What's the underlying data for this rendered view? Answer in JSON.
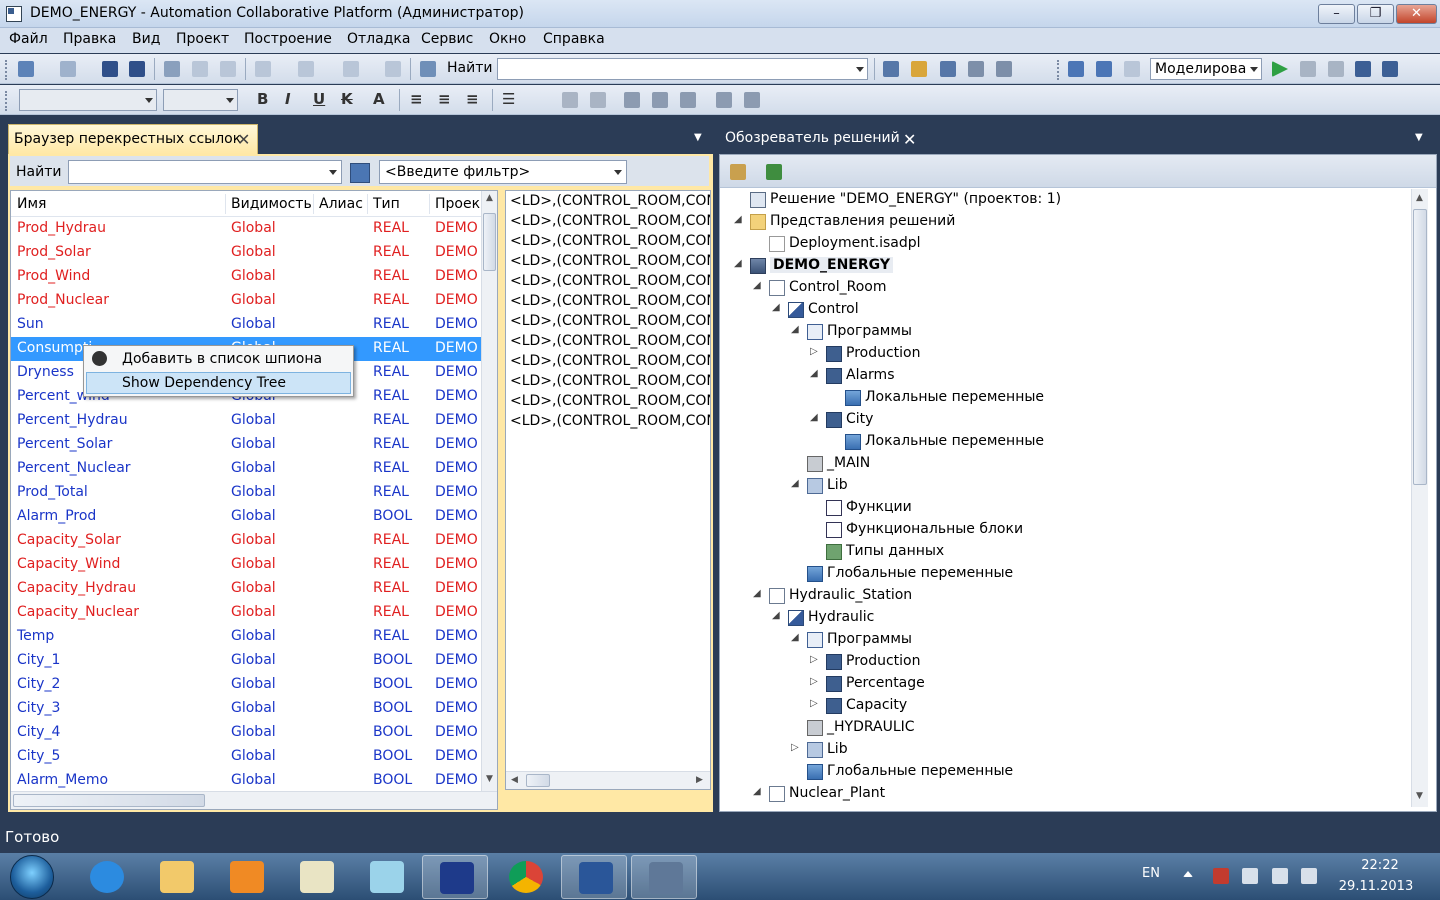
{
  "window": {
    "title": "DEMO_ENERGY - Automation Collaborative Platform (Администратор)",
    "min": "–",
    "max": "❐",
    "close": "✕"
  },
  "menu": [
    "Файл",
    "Правка",
    "Вид",
    "Проект",
    "Построение",
    "Отладка",
    "Сервис",
    "Окно",
    "Справка"
  ],
  "toolbar": {
    "find_label": "Найти",
    "find_value": "",
    "mode_value": "Моделирова"
  },
  "xref": {
    "tab_label": "Браузер перекрестных ссылок",
    "find_label": "Найти",
    "filter_placeholder": "<Введите фильтр>",
    "columns": [
      "Имя",
      "Видимость",
      "Алиас",
      "Тип",
      "Проек"
    ],
    "rows": [
      {
        "name": "Prod_Hydrau",
        "visibility": "Global",
        "alias": "",
        "type": "REAL",
        "project": "DEMO",
        "color": "#e02020"
      },
      {
        "name": "Prod_Solar",
        "visibility": "Global",
        "alias": "",
        "type": "REAL",
        "project": "DEMO",
        "color": "#e02020"
      },
      {
        "name": "Prod_Wind",
        "visibility": "Global",
        "alias": "",
        "type": "REAL",
        "project": "DEMO",
        "color": "#e02020"
      },
      {
        "name": "Prod_Nuclear",
        "visibility": "Global",
        "alias": "",
        "type": "REAL",
        "project": "DEMO",
        "color": "#e02020"
      },
      {
        "name": "Sun",
        "visibility": "Global",
        "alias": "",
        "type": "REAL",
        "project": "DEMO",
        "color": "#1a35c8"
      },
      {
        "name": "Consumpti",
        "visibility": "Global",
        "alias": "",
        "type": "REAL",
        "project": "DEMO",
        "color": "#1a35c8"
      },
      {
        "name": "Dryness",
        "visibility": "Global",
        "alias": "",
        "type": "REAL",
        "project": "DEMO",
        "color": "#1a35c8"
      },
      {
        "name": "Percent_wind",
        "visibility": "Global",
        "alias": "",
        "type": "REAL",
        "project": "DEMO",
        "color": "#1a35c8"
      },
      {
        "name": "Percent_Hydrau",
        "visibility": "Global",
        "alias": "",
        "type": "REAL",
        "project": "DEMO",
        "color": "#1a35c8"
      },
      {
        "name": "Percent_Solar",
        "visibility": "Global",
        "alias": "",
        "type": "REAL",
        "project": "DEMO",
        "color": "#1a35c8"
      },
      {
        "name": "Percent_Nuclear",
        "visibility": "Global",
        "alias": "",
        "type": "REAL",
        "project": "DEMO",
        "color": "#1a35c8"
      },
      {
        "name": "Prod_Total",
        "visibility": "Global",
        "alias": "",
        "type": "REAL",
        "project": "DEMO",
        "color": "#1a35c8"
      },
      {
        "name": "Alarm_Prod",
        "visibility": "Global",
        "alias": "",
        "type": "BOOL",
        "project": "DEMO",
        "color": "#1a35c8"
      },
      {
        "name": "Capacity_Solar",
        "visibility": "Global",
        "alias": "",
        "type": "REAL",
        "project": "DEMO",
        "color": "#e02020"
      },
      {
        "name": "Capacity_Wind",
        "visibility": "Global",
        "alias": "",
        "type": "REAL",
        "project": "DEMO",
        "color": "#e02020"
      },
      {
        "name": "Capacity_Hydrau",
        "visibility": "Global",
        "alias": "",
        "type": "REAL",
        "project": "DEMO",
        "color": "#e02020"
      },
      {
        "name": "Capacity_Nuclear",
        "visibility": "Global",
        "alias": "",
        "type": "REAL",
        "project": "DEMO",
        "color": "#e02020"
      },
      {
        "name": "Temp",
        "visibility": "Global",
        "alias": "",
        "type": "REAL",
        "project": "DEMO",
        "color": "#1a35c8"
      },
      {
        "name": "City_1",
        "visibility": "Global",
        "alias": "",
        "type": "BOOL",
        "project": "DEMO",
        "color": "#1a35c8"
      },
      {
        "name": "City_2",
        "visibility": "Global",
        "alias": "",
        "type": "BOOL",
        "project": "DEMO",
        "color": "#1a35c8"
      },
      {
        "name": "City_3",
        "visibility": "Global",
        "alias": "",
        "type": "BOOL",
        "project": "DEMO",
        "color": "#1a35c8"
      },
      {
        "name": "City_4",
        "visibility": "Global",
        "alias": "",
        "type": "BOOL",
        "project": "DEMO",
        "color": "#1a35c8"
      },
      {
        "name": "City_5",
        "visibility": "Global",
        "alias": "",
        "type": "BOOL",
        "project": "DEMO",
        "color": "#1a35c8"
      },
      {
        "name": "Alarm_Memo",
        "visibility": "Global",
        "alias": "",
        "type": "BOOL",
        "project": "DEMO",
        "color": "#1a35c8"
      }
    ],
    "selected_row": 5,
    "instructions": [
      "<LD>,(CONTROL_ROOM,CONT",
      "<LD>,(CONTROL_ROOM,CONT",
      "<LD>,(CONTROL_ROOM,CONT",
      "<LD>,(CONTROL_ROOM,CONT",
      "<LD>,(CONTROL_ROOM,CONT",
      "<LD>,(CONTROL_ROOM,CONT",
      "<LD>,(CONTROL_ROOM,CONT",
      "<LD>,(CONTROL_ROOM,CONT",
      "<LD>,(CONTROL_ROOM,CONT",
      "<LD>,(CONTROL_ROOM,CONT",
      "<LD>,(CONTROL_ROOM,CONT",
      "<LD>,(CONTROL_ROOM,CONT"
    ]
  },
  "context_menu": {
    "spy_label": "Добавить в список шпиона",
    "dependency_label": "Show Dependency Tree"
  },
  "solution": {
    "tab_label": "Обозреватель решений",
    "tree": [
      {
        "label": "Решение \"DEMO_ENERGY\"  (проектов: 1)",
        "level": 0,
        "exp": "",
        "icon": "sol"
      },
      {
        "label": "Представления решений",
        "level": 0,
        "exp": "◢",
        "icon": "folder"
      },
      {
        "label": "Deployment.isadpl",
        "level": 1,
        "exp": "",
        "icon": "file"
      },
      {
        "label": "DEMO_ENERGY",
        "level": 0,
        "exp": "◢",
        "icon": "proj",
        "bold": true
      },
      {
        "label": "Control_Room",
        "level": 1,
        "exp": "◢",
        "icon": "res"
      },
      {
        "label": "Control",
        "level": 2,
        "exp": "◢",
        "icon": "cfg"
      },
      {
        "label": "Программы",
        "level": 3,
        "exp": "◢",
        "icon": "prog"
      },
      {
        "label": "Production",
        "level": 4,
        "exp": "▷",
        "icon": "pou"
      },
      {
        "label": "Alarms",
        "level": 4,
        "exp": "◢",
        "icon": "pou"
      },
      {
        "label": "Локальные переменные",
        "level": 5,
        "exp": "",
        "icon": "vars"
      },
      {
        "label": "City",
        "level": 4,
        "exp": "◢",
        "icon": "pou"
      },
      {
        "label": "Локальные переменные",
        "level": 5,
        "exp": "",
        "icon": "vars"
      },
      {
        "label": "_MAIN",
        "level": 3,
        "exp": "",
        "icon": "main"
      },
      {
        "label": "Lib",
        "level": 3,
        "exp": "◢",
        "icon": "lib"
      },
      {
        "label": "Функции",
        "level": 4,
        "exp": "",
        "icon": "func"
      },
      {
        "label": "Функциональные блоки",
        "level": 4,
        "exp": "",
        "icon": "func"
      },
      {
        "label": "Типы данных",
        "level": 4,
        "exp": "",
        "icon": "type"
      },
      {
        "label": "Глобальные переменные",
        "level": 3,
        "exp": "",
        "icon": "vars"
      },
      {
        "label": "Hydraulic_Station",
        "level": 1,
        "exp": "◢",
        "icon": "res"
      },
      {
        "label": "Hydraulic",
        "level": 2,
        "exp": "◢",
        "icon": "cfg"
      },
      {
        "label": "Программы",
        "level": 3,
        "exp": "◢",
        "icon": "prog"
      },
      {
        "label": "Production",
        "level": 4,
        "exp": "▷",
        "icon": "pou"
      },
      {
        "label": "Percentage",
        "level": 4,
        "exp": "▷",
        "icon": "pou"
      },
      {
        "label": "Capacity",
        "level": 4,
        "exp": "▷",
        "icon": "pou"
      },
      {
        "label": "_HYDRAULIC",
        "level": 3,
        "exp": "",
        "icon": "main"
      },
      {
        "label": "Lib",
        "level": 3,
        "exp": "▷",
        "icon": "lib"
      },
      {
        "label": "Глобальные переменные",
        "level": 3,
        "exp": "",
        "icon": "vars"
      },
      {
        "label": "Nuclear_Plant",
        "level": 1,
        "exp": "◢",
        "icon": "res"
      }
    ]
  },
  "status": {
    "text": "Готово"
  },
  "taskbar": {
    "lang": "EN",
    "time": "22:22",
    "date": "29.11.2013"
  }
}
